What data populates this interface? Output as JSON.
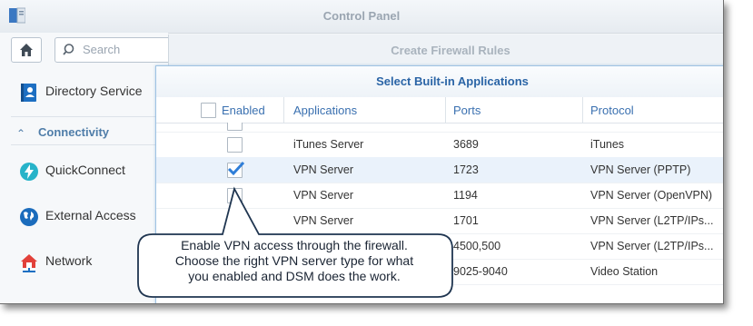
{
  "control_panel": {
    "title": "Control Panel"
  },
  "search": {
    "placeholder": "Search"
  },
  "sidebar": {
    "items": [
      {
        "label": "Directory Service",
        "icon": "directory-icon"
      },
      {
        "label": "QuickConnect",
        "icon": "quickconnect-icon"
      },
      {
        "label": "External Access",
        "icon": "globe-icon"
      },
      {
        "label": "Network",
        "icon": "network-icon"
      }
    ],
    "section": "Connectivity"
  },
  "firewall_window": {
    "title": "Create Firewall Rules"
  },
  "dialog": {
    "title": "Select Built-in Applications",
    "columns": {
      "enabled": "Enabled",
      "applications": "Applications",
      "ports": "Ports",
      "protocol": "Protocol"
    },
    "rows": [
      {
        "app": "iTunes Server",
        "ports": "3689",
        "protocol": "iTunes",
        "checked": false
      },
      {
        "app": "VPN Server",
        "ports": "1723",
        "protocol": "VPN Server (PPTP)",
        "checked": true
      },
      {
        "app": "VPN Server",
        "ports": "1194",
        "protocol": "VPN Server (OpenVPN)",
        "checked": false
      },
      {
        "app": "VPN Server",
        "ports": "1701",
        "protocol": "VPN Server (L2TP/IPs...",
        "checked": false
      },
      {
        "app": "",
        "ports": "4500,500",
        "protocol": "VPN Server (L2TP/IPs...",
        "checked": false
      },
      {
        "app": "",
        "ports": "9025-9040",
        "protocol": "Video Station",
        "checked": false
      }
    ]
  },
  "callout": {
    "line1": "Enable VPN access through the firewall.",
    "line2": "Choose the right VPN server type for what",
    "line3": "you enabled and DSM does the work."
  },
  "colors": {
    "accent": "#2a64a6",
    "selected_row": "#eaf2fb",
    "check": "#2f7ed8"
  }
}
